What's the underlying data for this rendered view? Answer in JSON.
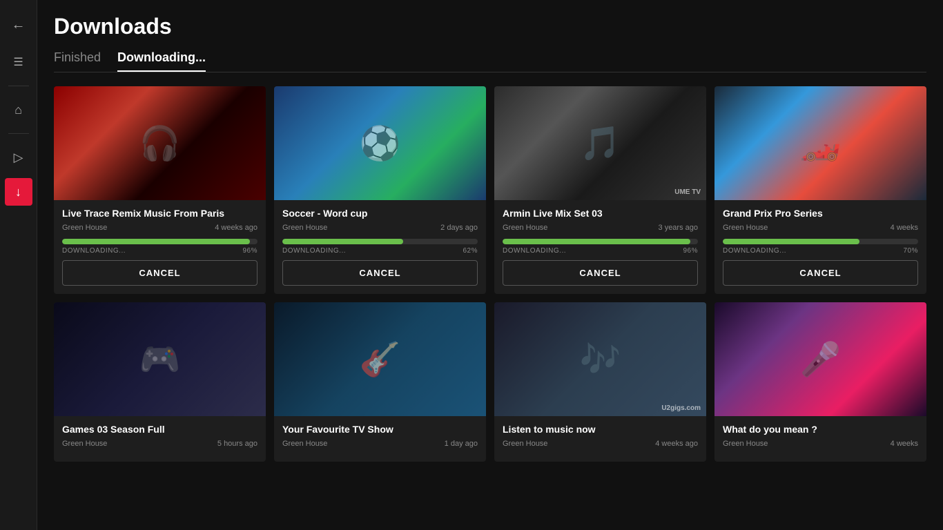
{
  "page": {
    "title": "Downloads"
  },
  "tabs": [
    {
      "id": "finished",
      "label": "Finished",
      "active": false
    },
    {
      "id": "downloading",
      "label": "Downloading...",
      "active": true
    }
  ],
  "sidebar": {
    "back_icon": "←",
    "menu_icon": "☰",
    "home_icon": "⌂",
    "play_icon": "▷",
    "download_icon": "↓"
  },
  "downloading_cards": [
    {
      "id": 1,
      "title": "Live Trace Remix Music From Paris",
      "channel": "Green House",
      "time_ago": "4 weeks ago",
      "progress_pct": 96,
      "progress_label": "DOWNLOADING...",
      "progress_pct_label": "96%",
      "cancel_label": "CANCEL",
      "thumb_class": "thumb-1",
      "thumb_icon": "🎧",
      "watermark": ""
    },
    {
      "id": 2,
      "title": "Soccer - Word cup",
      "channel": "Green House",
      "time_ago": "2 days ago",
      "progress_pct": 62,
      "progress_label": "DOWNLOADING...",
      "progress_pct_label": "62%",
      "cancel_label": "CANCEL",
      "thumb_class": "thumb-2",
      "thumb_icon": "⚽",
      "watermark": ""
    },
    {
      "id": 3,
      "title": "Armin Live Mix Set 03",
      "channel": "Green House",
      "time_ago": "3 years ago",
      "progress_pct": 96,
      "progress_label": "DOWNLOADING...",
      "progress_pct_label": "96%",
      "cancel_label": "CANCEL",
      "thumb_class": "thumb-3",
      "thumb_icon": "🎵",
      "watermark": "UME TV"
    },
    {
      "id": 4,
      "title": "Grand Prix Pro Series",
      "channel": "Green House",
      "time_ago": "4 weeks",
      "progress_pct": 70,
      "progress_label": "DOWNLOADING...",
      "progress_pct_label": "70%",
      "cancel_label": "CANCEL",
      "thumb_class": "thumb-4",
      "thumb_icon": "🏎️",
      "watermark": ""
    }
  ],
  "bottom_cards": [
    {
      "id": 5,
      "title": "Games 03 Season Full",
      "channel": "Green House",
      "time_ago": "5 hours ago",
      "thumb_class": "thumb-5",
      "thumb_icon": "🎮",
      "watermark": ""
    },
    {
      "id": 6,
      "title": "Your Favourite TV Show",
      "channel": "Green House",
      "time_ago": "1 day ago",
      "thumb_class": "thumb-6",
      "thumb_icon": "🎸",
      "watermark": ""
    },
    {
      "id": 7,
      "title": "Listen to music now",
      "channel": "Green House",
      "time_ago": "4 weeks ago",
      "thumb_class": "thumb-7",
      "thumb_icon": "🎶",
      "watermark": "U2gigs.com"
    },
    {
      "id": 8,
      "title": "What do you mean ?",
      "channel": "Green House",
      "time_ago": "4 weeks",
      "thumb_class": "thumb-8",
      "thumb_icon": "🎤",
      "watermark": ""
    }
  ]
}
